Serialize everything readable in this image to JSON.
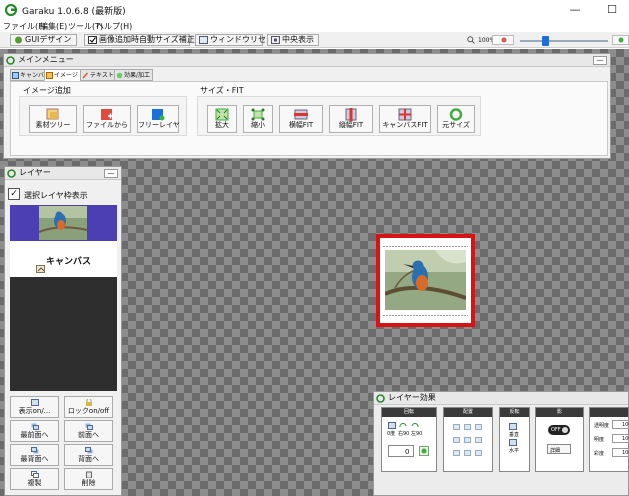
{
  "window": {
    "title": "Garaku 1.0.6.8 (最新版)",
    "minimize": "—",
    "maximize": "☐"
  },
  "menubar": [
    "ファイル(F)",
    "編集(E)",
    "ツール(T)",
    "ヘルプ(H)"
  ],
  "toolbar": {
    "gui_design": "GUIデザイン",
    "auto_size_checkbox": "画像追加時自動サイズ補正",
    "window_reset": "ウィンドウリセット",
    "center_display": "中央表示",
    "zoom": "100%"
  },
  "main_menu": {
    "title": "メインメニュー",
    "tabs": [
      "キャンバス",
      "イメージ",
      "テキスト",
      "効果/加工"
    ],
    "groups": [
      {
        "label": "イメージ追加",
        "buttons": [
          "素材ツリー",
          "ファイルから",
          "フリーレイヤ"
        ]
      },
      {
        "label": "サイズ・FIT",
        "buttons": [
          "拡大",
          "縮小",
          "横幅FIT",
          "縦幅FIT",
          "キャンバスFIT",
          "元サイズ"
        ]
      }
    ]
  },
  "layer_panel": {
    "title": "レイヤー",
    "show_frame_checkbox": "選択レイヤ枠表示",
    "canvas_layer_name": "キャンバス",
    "buttons": [
      "表示on/...",
      "ロックon/off",
      "最前面へ",
      "前面へ",
      "最背面へ",
      "背面へ",
      "複製",
      "削除"
    ]
  },
  "effect_panel": {
    "title": "レイヤー効果",
    "sections": [
      "回転",
      "配置",
      "反転",
      "影",
      ""
    ],
    "rotate_labels": [
      "0度",
      "右90",
      "左90"
    ],
    "rotate_value": "0",
    "flip_labels": [
      "垂直",
      "水平"
    ],
    "shadow_toggle": "OFF",
    "shadow_detail": "詳細",
    "opacity_labels": [
      "透明度",
      "明度",
      "彩度"
    ],
    "opacity_values": [
      "100",
      "100",
      "100"
    ]
  },
  "colors": {
    "accent_blue": "#1e6fd9",
    "selection_red": "#d51414",
    "layer_highlight": "#4b3fb3"
  }
}
